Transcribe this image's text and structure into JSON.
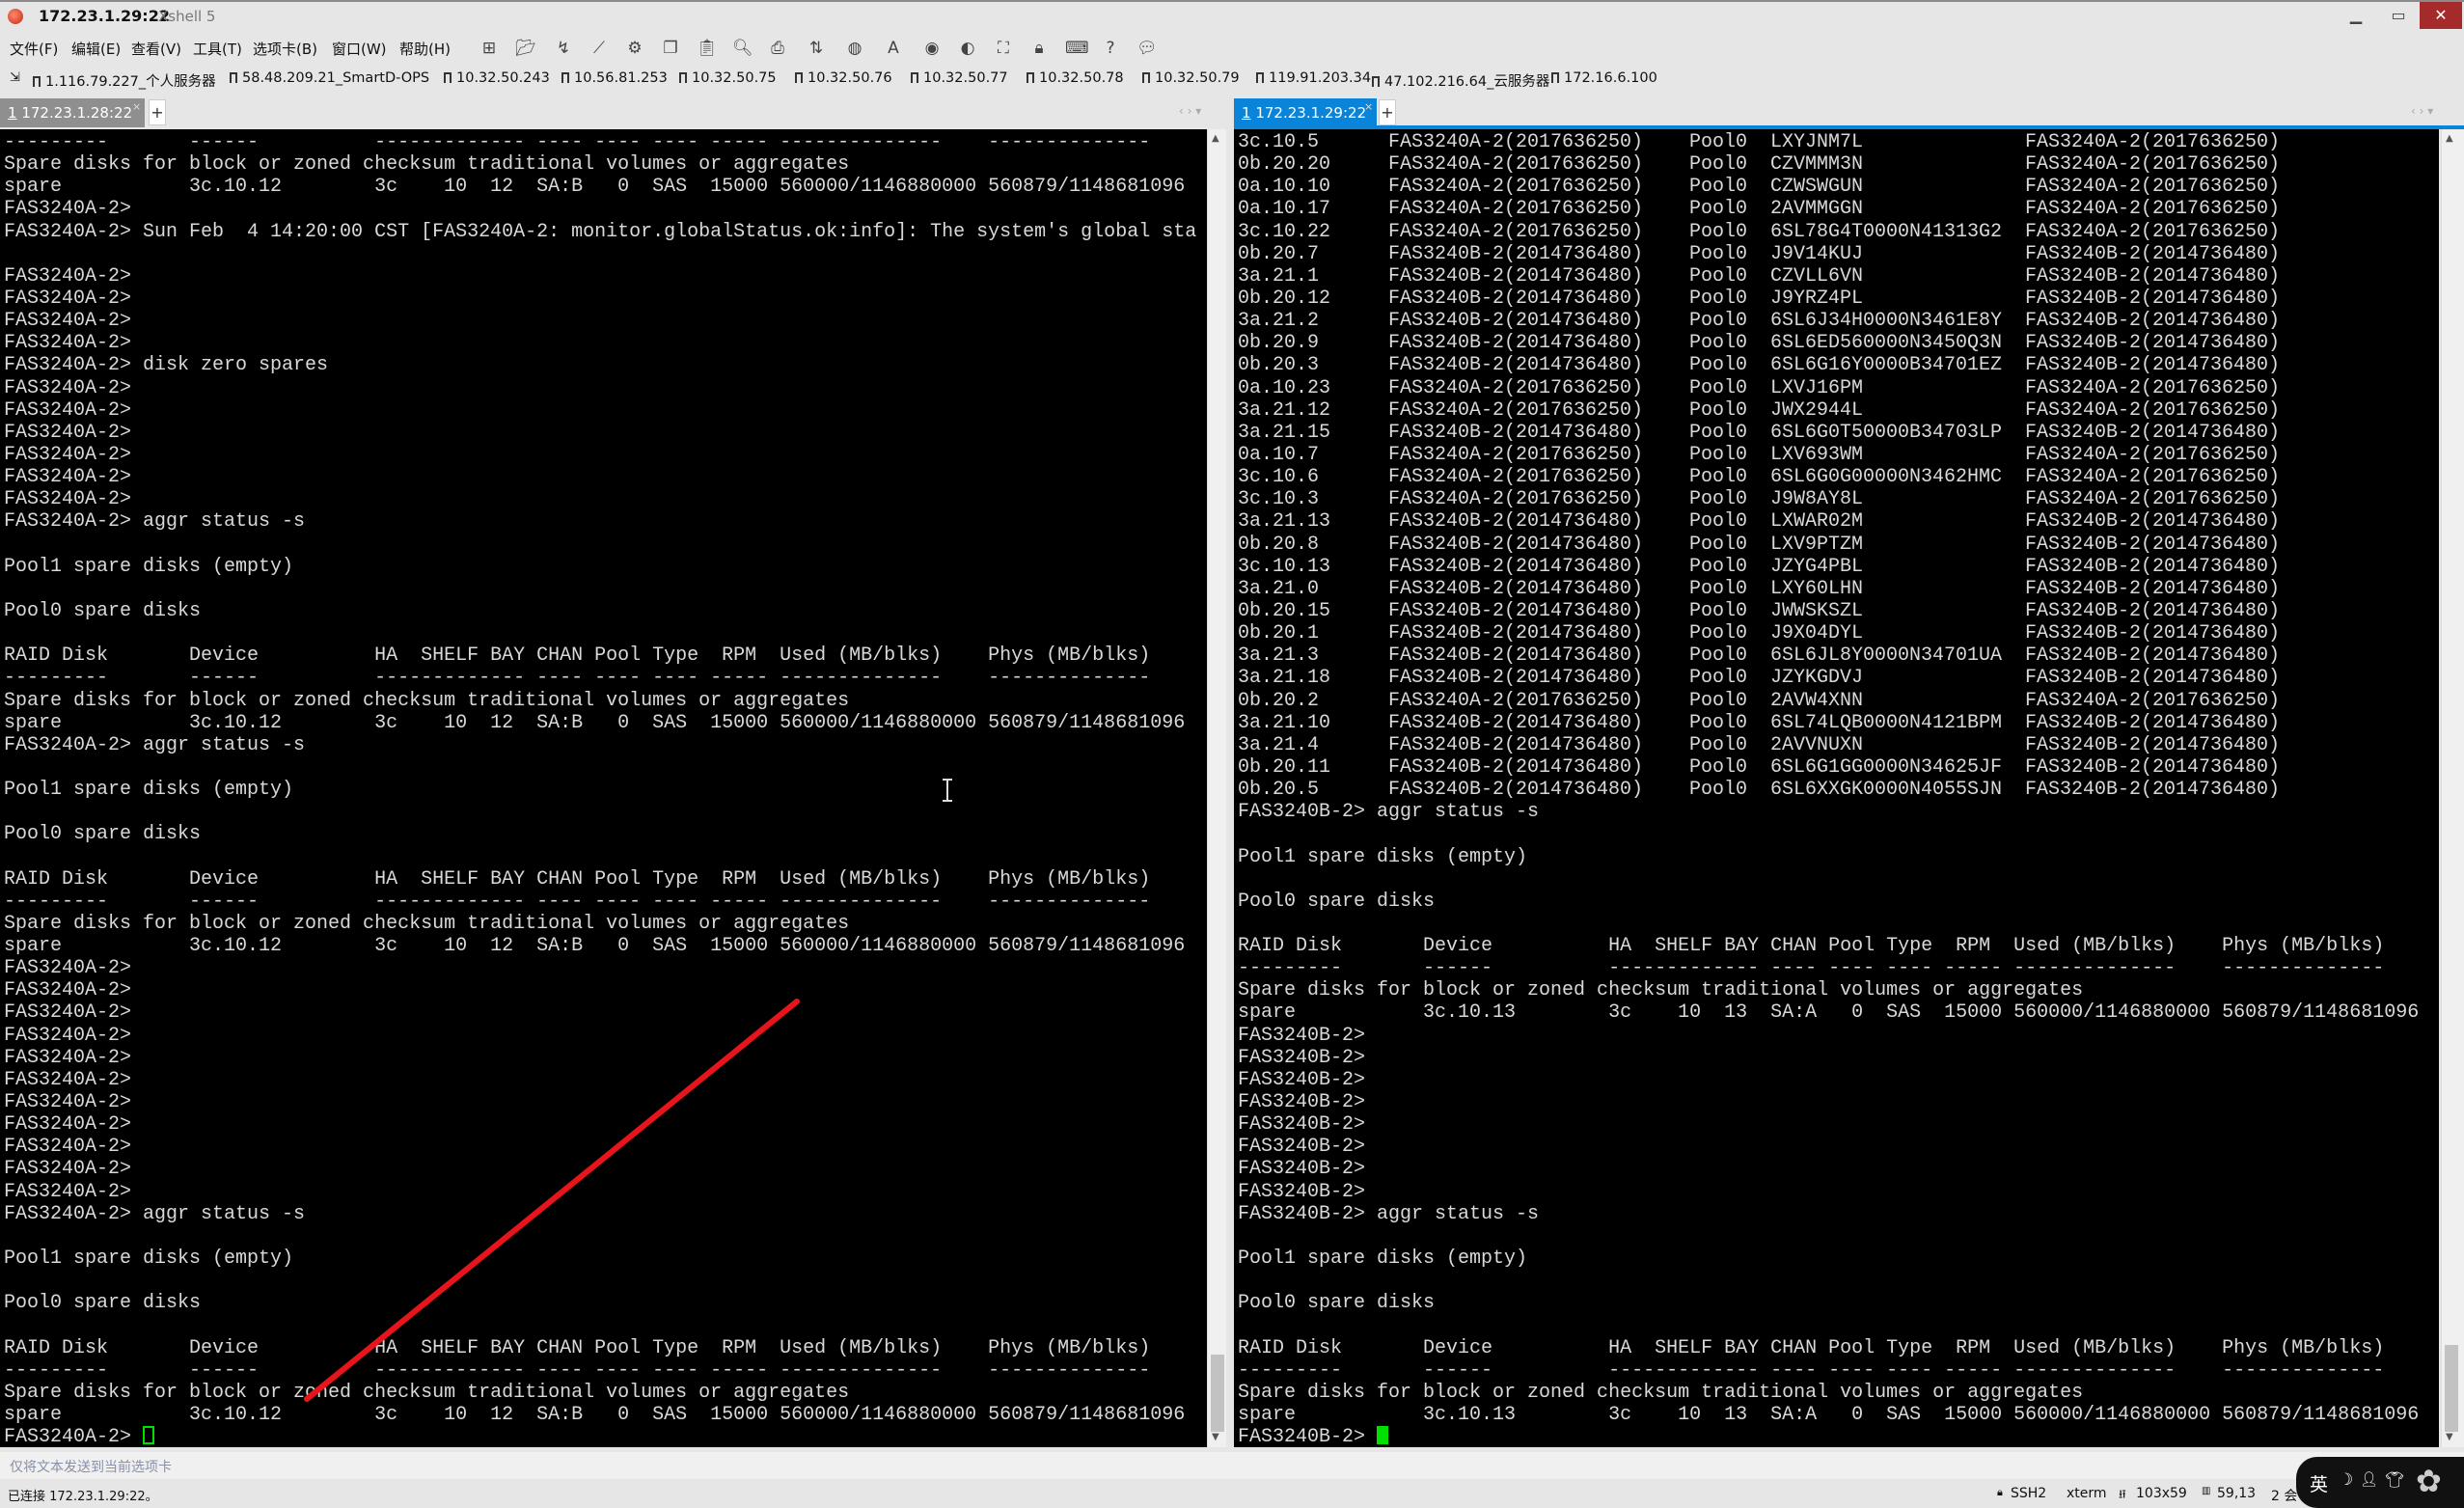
{
  "window": {
    "title": "172.23.1.29:22",
    "app_name": "Xshell 5",
    "minimize": "▁",
    "maximize": "▭",
    "close": "✕"
  },
  "menu": [
    "文件(F)",
    "编辑(E)",
    "查看(V)",
    "工具(T)",
    "选项卡(B)",
    "窗口(W)",
    "帮助(H)"
  ],
  "toolbar_icons": [
    "new-session-icon",
    "open-folder-icon",
    "reconnect-icon",
    "disconnect-icon",
    "properties-icon",
    "copy-icon",
    "paste-icon",
    "find-icon",
    "print-icon",
    "transfer-icon",
    "globe-icon",
    "font-icon",
    "xftp-icon",
    "xmanager-icon",
    "fullscreen-icon",
    "lock-icon",
    "keyboard-icon",
    "help-icon",
    "chat-icon"
  ],
  "bookmarks": [
    "1.116.79.227_个人服务器",
    "58.48.209.21_SmartD-OPS",
    "10.32.50.243",
    "10.56.81.253",
    "10.32.50.75",
    "10.32.50.76",
    "10.32.50.77",
    "10.32.50.78",
    "10.32.50.79",
    "119.91.203.34",
    "47.102.216.64_云服务器",
    "172.16.6.100"
  ],
  "tabs": {
    "left": {
      "index": "1",
      "label": "172.23.1.28:22",
      "close": "×",
      "add": "+",
      "color": "#8f8f8f"
    },
    "right": {
      "index": "1",
      "label": "172.23.1.29:22",
      "close": "×",
      "add": "+",
      "color": "#0a84d8"
    }
  },
  "left_pane": {
    "lines": [
      "---------       ------          ------------- ---- ---- ---- ----- --------------    --------------",
      "Spare disks for block or zoned checksum traditional volumes or aggregates",
      "spare           3c.10.12        3c    10  12  SA:B   0  SAS  15000 560000/1146880000 560879/1148681096",
      "FAS3240A-2>",
      "FAS3240A-2> Sun Feb  4 14:20:00 CST [FAS3240A-2: monitor.globalStatus.ok:info]: The system's global sta",
      "",
      "FAS3240A-2>",
      "FAS3240A-2>",
      "FAS3240A-2>",
      "FAS3240A-2>",
      "FAS3240A-2> disk zero spares",
      "FAS3240A-2>",
      "FAS3240A-2>",
      "FAS3240A-2>",
      "FAS3240A-2>",
      "FAS3240A-2>",
      "FAS3240A-2>",
      "FAS3240A-2> aggr status -s",
      "",
      "Pool1 spare disks (empty)",
      "",
      "Pool0 spare disks",
      "",
      "RAID Disk       Device          HA  SHELF BAY CHAN Pool Type  RPM  Used (MB/blks)    Phys (MB/blks)",
      "---------       ------          ------------- ---- ---- ---- ----- --------------    --------------",
      "Spare disks for block or zoned checksum traditional volumes or aggregates",
      "spare           3c.10.12        3c    10  12  SA:B   0  SAS  15000 560000/1146880000 560879/1148681096",
      "FAS3240A-2> aggr status -s",
      "",
      "Pool1 spare disks (empty)",
      "",
      "Pool0 spare disks",
      "",
      "RAID Disk       Device          HA  SHELF BAY CHAN Pool Type  RPM  Used (MB/blks)    Phys (MB/blks)",
      "---------       ------          ------------- ---- ---- ---- ----- --------------    --------------",
      "Spare disks for block or zoned checksum traditional volumes or aggregates",
      "spare           3c.10.12        3c    10  12  SA:B   0  SAS  15000 560000/1146880000 560879/1148681096",
      "FAS3240A-2>",
      "FAS3240A-2>",
      "FAS3240A-2>",
      "FAS3240A-2>",
      "FAS3240A-2>",
      "FAS3240A-2>",
      "FAS3240A-2>",
      "FAS3240A-2>",
      "FAS3240A-2>",
      "FAS3240A-2>",
      "FAS3240A-2>",
      "FAS3240A-2> aggr status -s",
      "",
      "Pool1 spare disks (empty)",
      "",
      "Pool0 spare disks",
      "",
      "RAID Disk       Device          HA  SHELF BAY CHAN Pool Type  RPM  Used (MB/blks)    Phys (MB/blks)",
      "---------       ------          ------------- ---- ---- ---- ----- --------------    --------------",
      "Spare disks for block or zoned checksum traditional volumes or aggregates",
      "spare           3c.10.12        3c    10  12  SA:B   0  SAS  15000 560000/1146880000 560879/1148681096",
      "FAS3240A-2> "
    ]
  },
  "right_pane": {
    "disk_rows": [
      [
        "3c.10.5",
        "FAS3240A-2(2017636250)",
        "Pool0",
        "LXYJNM7L",
        "FAS3240A-2(2017636250)"
      ],
      [
        "0b.20.20",
        "FAS3240A-2(2017636250)",
        "Pool0",
        "CZVMMM3N",
        "FAS3240A-2(2017636250)"
      ],
      [
        "0a.10.10",
        "FAS3240A-2(2017636250)",
        "Pool0",
        "CZWSWGUN",
        "FAS3240A-2(2017636250)"
      ],
      [
        "0a.10.17",
        "FAS3240A-2(2017636250)",
        "Pool0",
        "2AVMMGGN",
        "FAS3240A-2(2017636250)"
      ],
      [
        "3c.10.22",
        "FAS3240A-2(2017636250)",
        "Pool0",
        "6SL78G4T0000N41313G2",
        "FAS3240A-2(2017636250)"
      ],
      [
        "0b.20.7",
        "FAS3240B-2(2014736480)",
        "Pool0",
        "J9V14KUJ",
        "FAS3240B-2(2014736480)"
      ],
      [
        "3a.21.1",
        "FAS3240B-2(2014736480)",
        "Pool0",
        "CZVLL6VN",
        "FAS3240B-2(2014736480)"
      ],
      [
        "0b.20.12",
        "FAS3240B-2(2014736480)",
        "Pool0",
        "J9YRZ4PL",
        "FAS3240B-2(2014736480)"
      ],
      [
        "3a.21.2",
        "FAS3240B-2(2014736480)",
        "Pool0",
        "6SL6J34H0000N3461E8Y",
        "FAS3240B-2(2014736480)"
      ],
      [
        "0b.20.9",
        "FAS3240B-2(2014736480)",
        "Pool0",
        "6SL6ED560000N3450Q3N",
        "FAS3240B-2(2014736480)"
      ],
      [
        "0b.20.3",
        "FAS3240B-2(2014736480)",
        "Pool0",
        "6SL6G16Y0000B34701EZ",
        "FAS3240B-2(2014736480)"
      ],
      [
        "0a.10.23",
        "FAS3240A-2(2017636250)",
        "Pool0",
        "LXVJ16PM",
        "FAS3240A-2(2017636250)"
      ],
      [
        "3a.21.12",
        "FAS3240A-2(2017636250)",
        "Pool0",
        "JWX2944L",
        "FAS3240A-2(2017636250)"
      ],
      [
        "3a.21.15",
        "FAS3240B-2(2014736480)",
        "Pool0",
        "6SL6G0T50000B34703LP",
        "FAS3240B-2(2014736480)"
      ],
      [
        "0a.10.7",
        "FAS3240A-2(2017636250)",
        "Pool0",
        "LXV693WM",
        "FAS3240A-2(2017636250)"
      ],
      [
        "3c.10.6",
        "FAS3240A-2(2017636250)",
        "Pool0",
        "6SL6G0G00000N3462HMC",
        "FAS3240A-2(2017636250)"
      ],
      [
        "3c.10.3",
        "FAS3240A-2(2017636250)",
        "Pool0",
        "J9W8AY8L",
        "FAS3240A-2(2017636250)"
      ],
      [
        "3a.21.13",
        "FAS3240B-2(2014736480)",
        "Pool0",
        "LXWAR02M",
        "FAS3240B-2(2014736480)"
      ],
      [
        "0b.20.8",
        "FAS3240B-2(2014736480)",
        "Pool0",
        "LXV9PTZM",
        "FAS3240B-2(2014736480)"
      ],
      [
        "3c.10.13",
        "FAS3240B-2(2014736480)",
        "Pool0",
        "JZYG4PBL",
        "FAS3240B-2(2014736480)"
      ],
      [
        "3a.21.0",
        "FAS3240B-2(2014736480)",
        "Pool0",
        "LXY60LHN",
        "FAS3240B-2(2014736480)"
      ],
      [
        "0b.20.15",
        "FAS3240B-2(2014736480)",
        "Pool0",
        "JWWSKSZL",
        "FAS3240B-2(2014736480)"
      ],
      [
        "0b.20.1",
        "FAS3240B-2(2014736480)",
        "Pool0",
        "J9X04DYL",
        "FAS3240B-2(2014736480)"
      ],
      [
        "3a.21.3",
        "FAS3240B-2(2014736480)",
        "Pool0",
        "6SL6JL8Y0000N34701UA",
        "FAS3240B-2(2014736480)"
      ],
      [
        "3a.21.18",
        "FAS3240B-2(2014736480)",
        "Pool0",
        "JZYKGDVJ",
        "FAS3240B-2(2014736480)"
      ],
      [
        "0b.20.2",
        "FAS3240A-2(2017636250)",
        "Pool0",
        "2AVW4XNN",
        "FAS3240A-2(2017636250)"
      ],
      [
        "3a.21.10",
        "FAS3240B-2(2014736480)",
        "Pool0",
        "6SL74LQB0000N4121BPM",
        "FAS3240B-2(2014736480)"
      ],
      [
        "3a.21.4",
        "FAS3240B-2(2014736480)",
        "Pool0",
        "2AVVNUXN",
        "FAS3240B-2(2014736480)"
      ],
      [
        "0b.20.11",
        "FAS3240B-2(2014736480)",
        "Pool0",
        "6SL6G1GG0000N34625JF",
        "FAS3240B-2(2014736480)"
      ],
      [
        "0b.20.5",
        "FAS3240B-2(2014736480)",
        "Pool0",
        "6SL6XXGK0000N4055SJN",
        "FAS3240B-2(2014736480)"
      ]
    ],
    "lines": [
      "FAS3240B-2> aggr status -s",
      "",
      "Pool1 spare disks (empty)",
      "",
      "Pool0 spare disks",
      "",
      "RAID Disk       Device          HA  SHELF BAY CHAN Pool Type  RPM  Used (MB/blks)    Phys (MB/blks)",
      "---------       ------          ------------- ---- ---- ---- ----- --------------    --------------",
      "Spare disks for block or zoned checksum traditional volumes or aggregates",
      "spare           3c.10.13        3c    10  13  SA:A   0  SAS  15000 560000/1146880000 560879/1148681096",
      "FAS3240B-2>",
      "FAS3240B-2>",
      "FAS3240B-2>",
      "FAS3240B-2>",
      "FAS3240B-2>",
      "FAS3240B-2>",
      "FAS3240B-2>",
      "FAS3240B-2>",
      "FAS3240B-2> aggr status -s",
      "",
      "Pool1 spare disks (empty)",
      "",
      "Pool0 spare disks",
      "",
      "RAID Disk       Device          HA  SHELF BAY CHAN Pool Type  RPM  Used (MB/blks)    Phys (MB/blks)",
      "---------       ------          ------------- ---- ---- ---- ----- --------------    --------------",
      "Spare disks for block or zoned checksum traditional volumes or aggregates",
      "spare           3c.10.13        3c    10  13  SA:A   0  SAS  15000 560000/1146880000 560879/1148681096",
      "FAS3240B-2> "
    ]
  },
  "compose_bar": {
    "placeholder": "仅将文本发送到当前选项卡"
  },
  "status_bar": {
    "connection": "已连接 172.23.1.29:22。",
    "protocol": "SSH2",
    "terminal_type": "xterm",
    "size": "103x59",
    "cursor_pos": "59,13",
    "sessions": "2 会"
  },
  "ime": {
    "mode": "英"
  },
  "colors": {
    "terminal_bg": "#000000",
    "terminal_fg": "#d9d9d9",
    "cursor": "#00e000",
    "annotation": "#e8141c",
    "active_tab": "#0a84d8",
    "close_button": "#a52b2b"
  }
}
